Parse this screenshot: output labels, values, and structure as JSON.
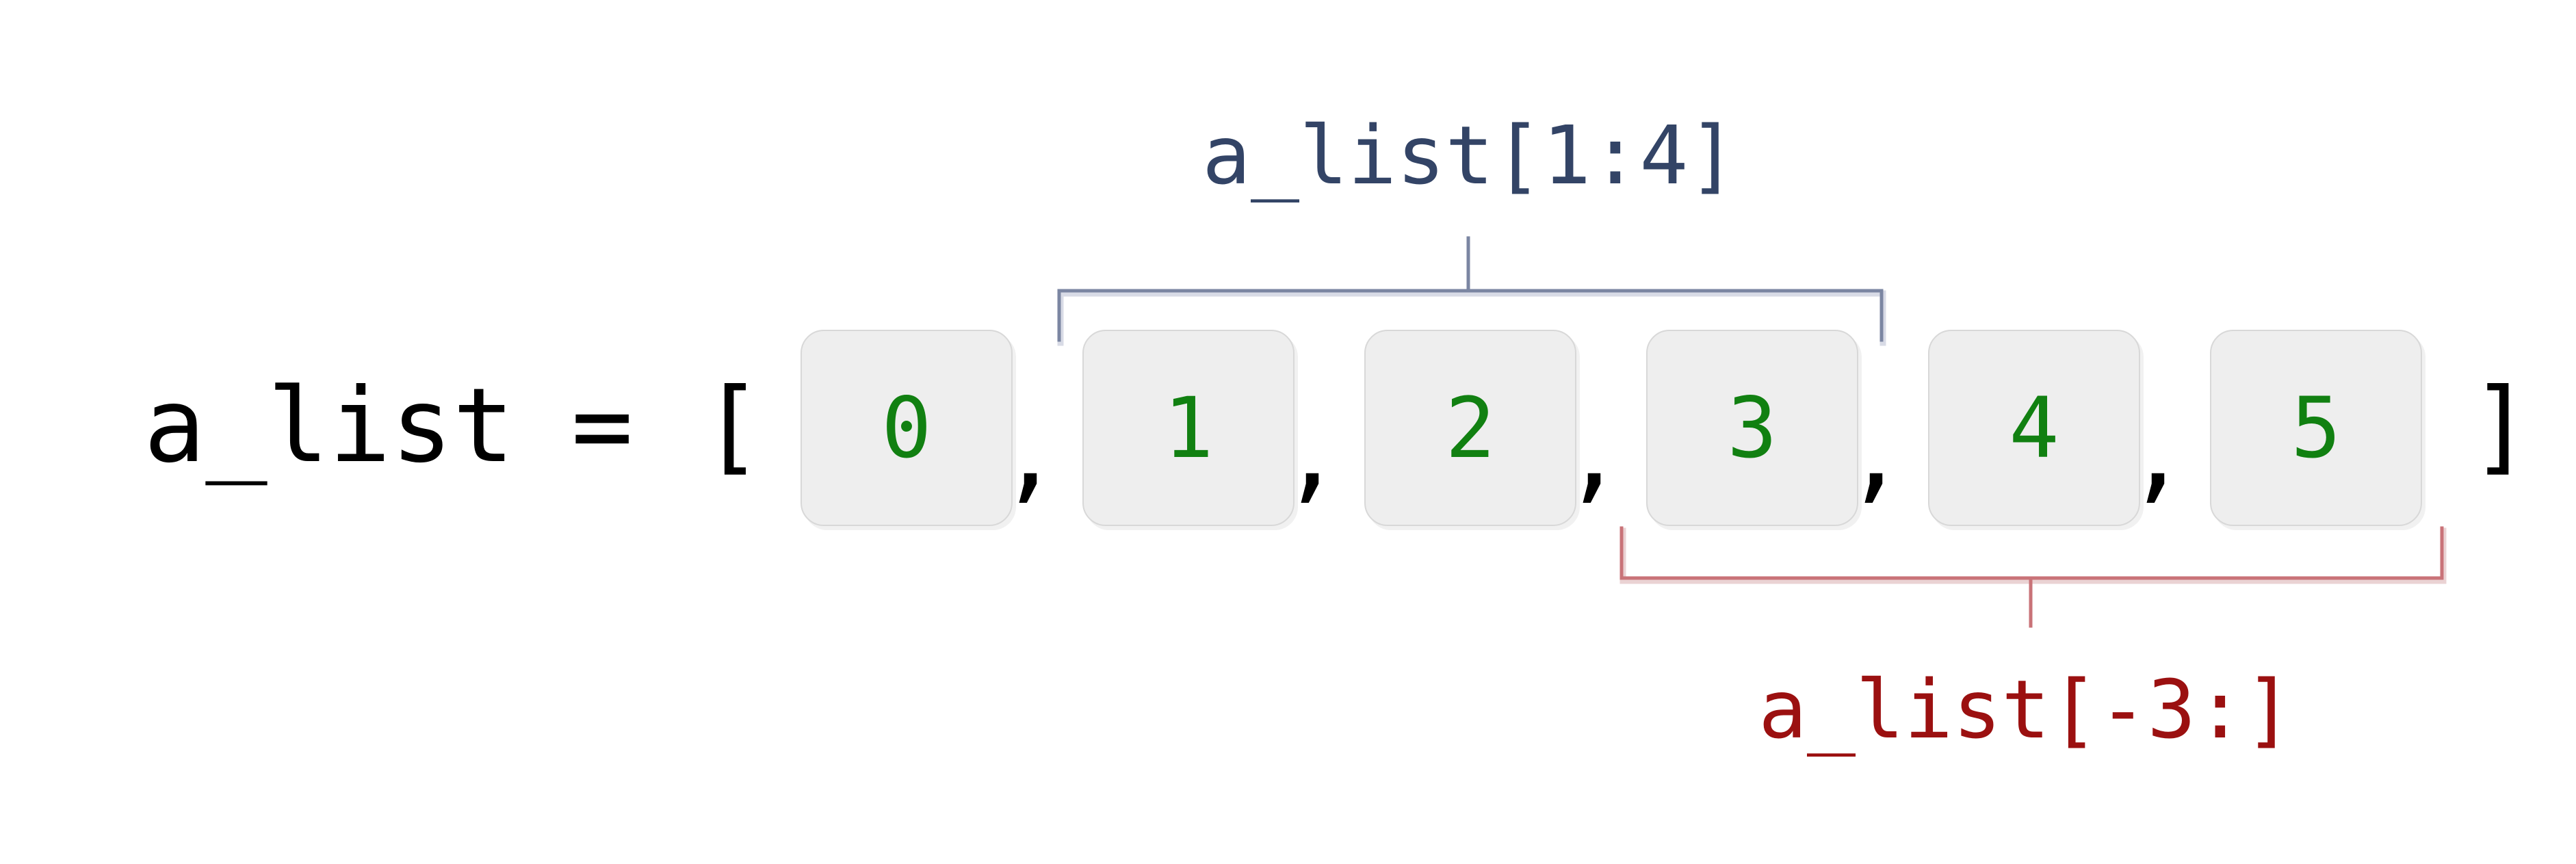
{
  "code": {
    "var_name": "a_list",
    "equals": "=",
    "open_bracket": "[",
    "close_bracket": "]",
    "separator": ","
  },
  "cells": [
    "0",
    "1",
    "2",
    "3",
    "4",
    "5"
  ],
  "slices": {
    "top": {
      "label": "a_list[1:4]",
      "color": "#334466"
    },
    "bottom": {
      "label": "a_list[-3:]",
      "color": "#9b1010"
    }
  },
  "colors": {
    "cell_value": "#118011",
    "cell_background": "#eeeeee",
    "code_text": "#000000"
  }
}
